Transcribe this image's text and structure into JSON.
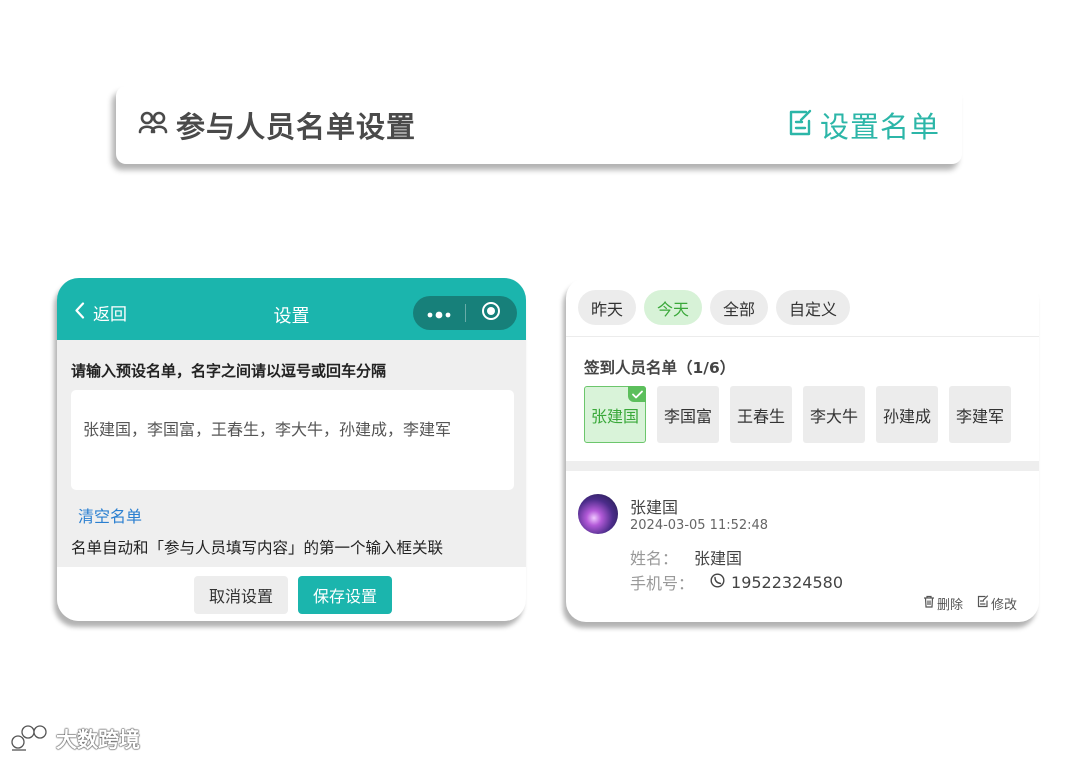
{
  "header": {
    "title": "参与人员名单设置",
    "action_label": "设置名单",
    "accent_color": "#2cb6a8",
    "title_icon": "people-icon",
    "action_icon": "edit-icon"
  },
  "settings_panel": {
    "back_label": "返回",
    "title": "设置",
    "instruction": "请输入预设名单，名字之间请以逗号或回车分隔",
    "names_value": "张建国，李国富，王春生，李大牛，孙建成，李建军",
    "clear_label": "清空名单",
    "note": "名单自动和「参与人员填写内容」的第一个输入框关联",
    "cancel_label": "取消设置",
    "save_label": "保存设置",
    "header_color": "#1bb5ad"
  },
  "checkin_panel": {
    "filters": [
      {
        "label": "昨天",
        "active": false
      },
      {
        "label": "今天",
        "active": true
      },
      {
        "label": "全部",
        "active": false
      },
      {
        "label": "自定义",
        "active": false
      }
    ],
    "section_title": "签到人员名单（1/6）",
    "people": [
      {
        "name": "张建国",
        "selected": true
      },
      {
        "name": "李国富",
        "selected": false
      },
      {
        "name": "王春生",
        "selected": false
      },
      {
        "name": "李大牛",
        "selected": false
      },
      {
        "name": "孙建成",
        "selected": false
      },
      {
        "name": "李建军",
        "selected": false
      }
    ],
    "record": {
      "name": "张建国",
      "time": "2024-03-05 11:52:48",
      "name_label": "姓名：",
      "name_value": "张建国",
      "phone_label": "手机号：",
      "phone_value": "19522324580",
      "delete_label": "删除",
      "edit_label": "修改"
    }
  },
  "watermark": {
    "text": "大数跨境"
  }
}
